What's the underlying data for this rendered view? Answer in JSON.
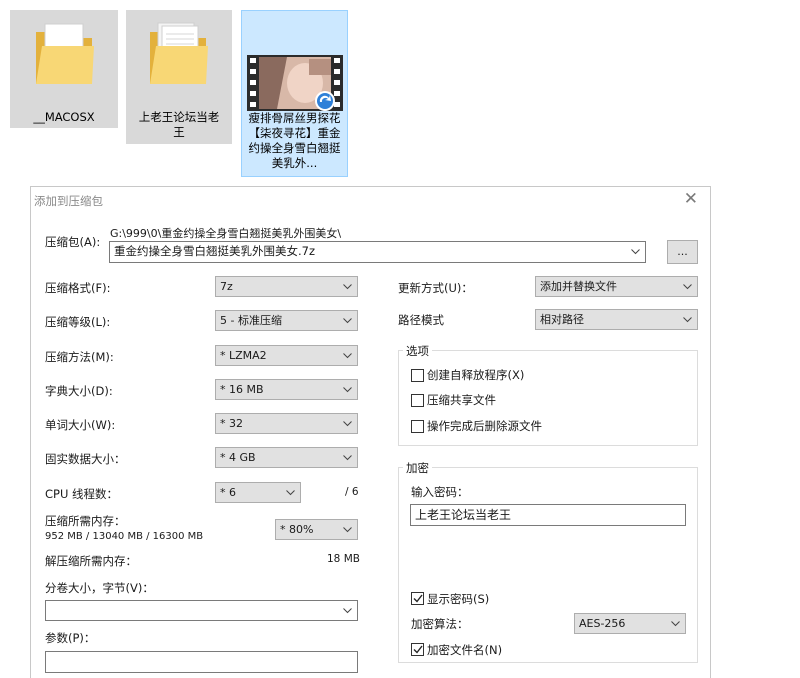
{
  "desktop": {
    "items": [
      {
        "name": "__MACOSX"
      },
      {
        "name": "上老王论坛当老王"
      },
      {
        "name": "瘦排骨屌丝男探花【柒夜寻花】重金约操全身雪白翘挺美乳外..."
      }
    ]
  },
  "dialog": {
    "title": "添加到压缩包",
    "archive": {
      "label": "压缩包(A):",
      "path": "G:\\999\\0\\重金约操全身雪白翘挺美乳外围美女\\",
      "name": "重金约操全身雪白翘挺美乳外围美女.7z",
      "browse_label": "..."
    },
    "left": {
      "format": {
        "label": "压缩格式(F):",
        "value": "7z"
      },
      "level": {
        "label": "压缩等级(L):",
        "value": "5 - 标准压缩"
      },
      "method": {
        "label": "压缩方法(M):",
        "value": "* LZMA2"
      },
      "dict": {
        "label": "字典大小(D):",
        "value": "* 16 MB"
      },
      "word": {
        "label": "单词大小(W):",
        "value": "* 32"
      },
      "solid": {
        "label": "固实数据大小：",
        "value": "* 4 GB"
      },
      "cpu": {
        "label": "CPU 线程数：",
        "value": "* 6",
        "max": "/ 6"
      },
      "mem_compress": {
        "label": "压缩所需内存：",
        "detail": "952 MB / 13040 MB / 16300 MB",
        "value": "* 80%"
      },
      "mem_decompress": {
        "label": "解压缩所需内存：",
        "value": "18 MB"
      },
      "volume": {
        "label": "分卷大小，字节(V)：",
        "value": ""
      },
      "params": {
        "label": "参数(P)：",
        "value": ""
      }
    },
    "right": {
      "update": {
        "label": "更新方式(U)：",
        "value": "添加并替换文件"
      },
      "path_mode": {
        "label": "路径模式",
        "value": "相对路径"
      },
      "options": {
        "title": "选项",
        "items": [
          {
            "label": "创建自释放程序(X)"
          },
          {
            "label": "压缩共享文件"
          },
          {
            "label": "操作完成后删除源文件"
          }
        ]
      },
      "encryption": {
        "title": "加密",
        "password_label": "输入密码：",
        "password_value": "上老王论坛当老王",
        "show_password": "显示密码(S)",
        "method_label": "加密算法：",
        "method_value": "AES-256",
        "encrypt_names": "加密文件名(N)"
      }
    }
  }
}
